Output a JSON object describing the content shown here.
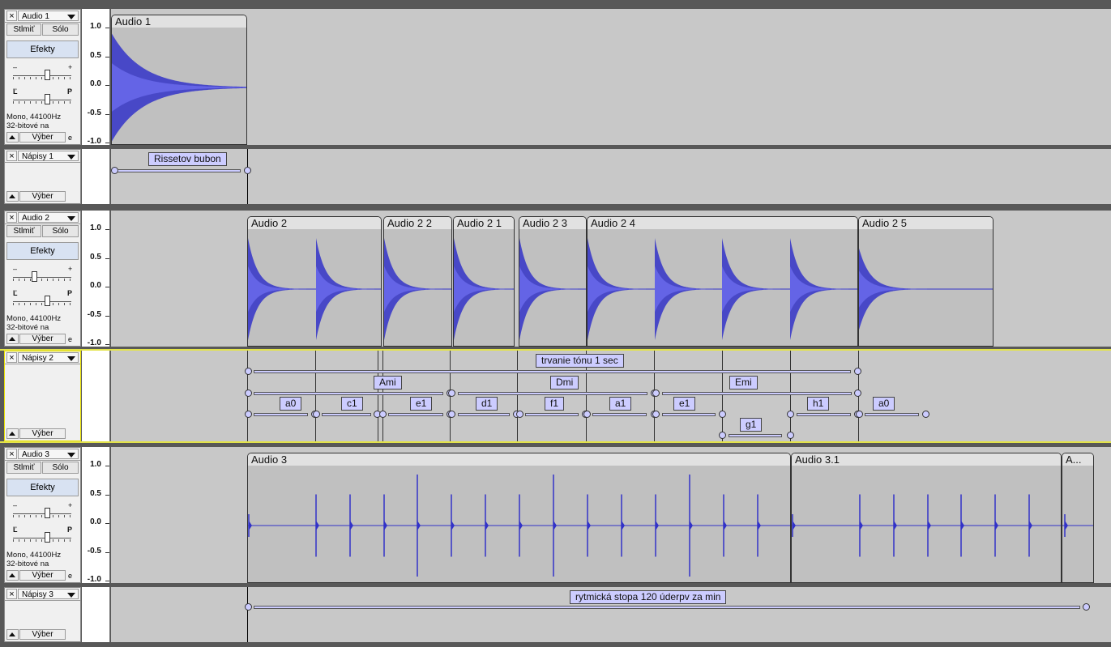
{
  "common": {
    "mute": "Stlmiť",
    "solo": "Sólo",
    "effects": "Efekty",
    "select": "Výber",
    "gain_minus": "–",
    "gain_plus": "+",
    "pan_left": "Ľ",
    "pan_right": "P",
    "info_line1": "Mono, 44100Hz",
    "info_line2": "32-bitové na",
    "resize_hint": "e",
    "close": "×"
  },
  "ruler": {
    "labels": [
      "1.0",
      "0.5",
      "0.0",
      "-0.5",
      "-1.0"
    ]
  },
  "tracks": {
    "audio1": {
      "name": "Audio 1",
      "gain_level": 0.6,
      "pan_level": 0.6,
      "clips": [
        "Audio 1"
      ]
    },
    "labels1": {
      "name": "Nápisy 1",
      "labels": [
        "Rissetov bubon"
      ]
    },
    "audio2": {
      "name": "Audio 2",
      "gain_level": 0.35,
      "pan_level": 0.6,
      "clips": [
        "Audio 2",
        "Audio 2 2",
        "Audio 2 1",
        "Audio 2 3",
        "Audio 2 4",
        "Audio 2 5"
      ]
    },
    "labels2": {
      "name": "Nápisy 2",
      "labels": [
        "trvanie tónu 1 sec",
        "Ami",
        "Dmi",
        "Emi",
        "a0",
        "c1",
        "e1",
        "d1",
        "f1",
        "a1",
        "e1",
        "h1",
        "a0",
        "g1"
      ]
    },
    "audio3": {
      "name": "Audio 3",
      "gain_level": 0.6,
      "pan_level": 0.6,
      "clips": [
        "Audio 3",
        "Audio 3.1",
        "A..."
      ]
    },
    "labels3": {
      "name": "Nápisy 3",
      "labels": [
        "rytmická stopa 120 úderpv za min"
      ]
    }
  },
  "colors": {
    "wave": "#3232c8",
    "label_fill": "#ccccff",
    "selected_border": "#e3e34a",
    "clip_bg": "#c0c0c0"
  }
}
